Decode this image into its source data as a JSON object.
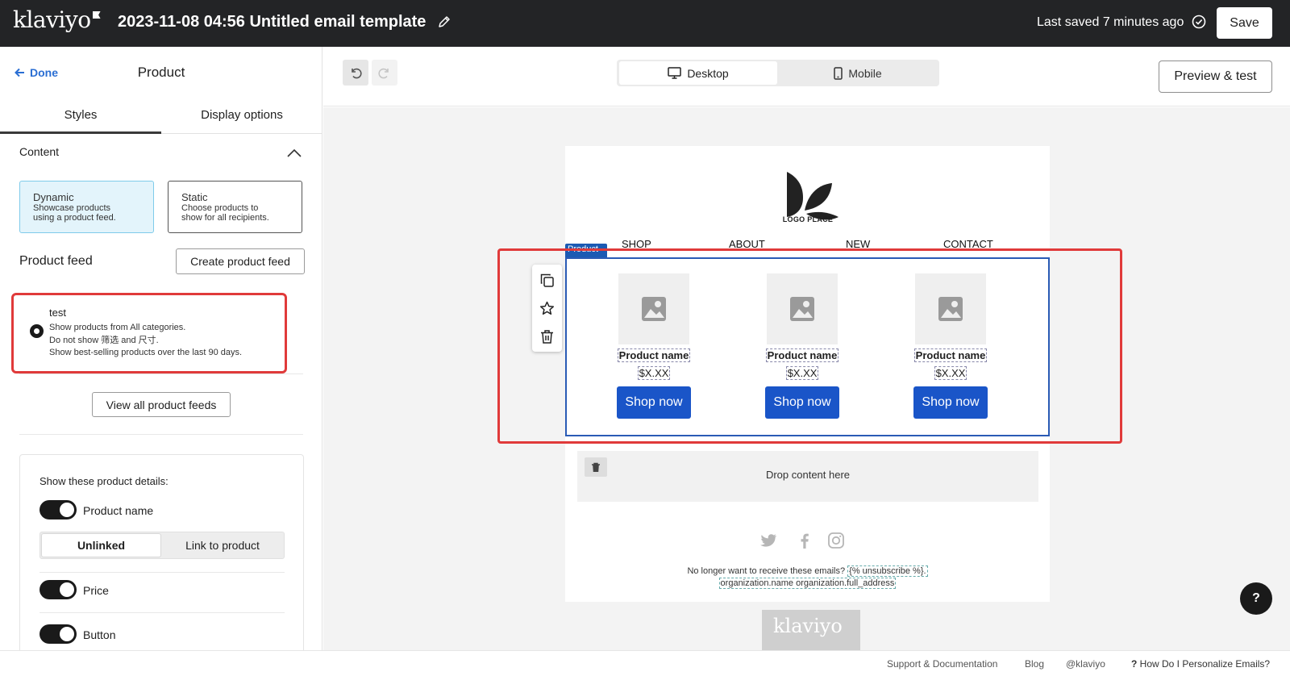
{
  "header": {
    "logo_text": "klaviyo",
    "title": "2023-11-08 04:56 Untitled email template",
    "saved_status": "Last saved 7 minutes ago",
    "save_label": "Save"
  },
  "panel": {
    "done_label": "Done",
    "title": "Product",
    "tabs": [
      "Styles",
      "Display options"
    ],
    "content_label": "Content",
    "modes": [
      {
        "title": "Dynamic",
        "desc1": "Showcase products",
        "desc2": "using a product feed."
      },
      {
        "title": "Static",
        "desc1": "Choose products to",
        "desc2": "show for all recipients."
      }
    ],
    "product_feed_label": "Product feed",
    "create_feed_label": "Create product feed",
    "feed": {
      "name": "test",
      "line1": "Show products from All categories.",
      "line2": "Do not show 筛选 and 尺寸.",
      "line3": "Show best-selling products over the last 90 days."
    },
    "view_all_label": "View all product feeds",
    "details_title": "Show these product details:",
    "toggles": [
      "Product name",
      "Price",
      "Button"
    ],
    "link_options": [
      "Unlinked",
      "Link to product"
    ]
  },
  "toolbar": {
    "desktop_label": "Desktop",
    "mobile_label": "Mobile",
    "preview_label": "Preview & test"
  },
  "email": {
    "logo_caption": "LOGO PLACE",
    "nav": [
      "SHOP",
      "ABOUT",
      "NEW",
      "CONTACT"
    ],
    "block_tag": "Product",
    "products": [
      {
        "name": "Product name",
        "price": "$X.XX",
        "button": "Shop now"
      },
      {
        "name": "Product name",
        "price": "$X.XX",
        "button": "Shop now"
      },
      {
        "name": "Product name",
        "price": "$X.XX",
        "button": "Shop now"
      }
    ],
    "drop_text": "Drop content here",
    "unsub_text": "No longer want to receive these emails?",
    "unsub_tag": "{% unsubscribe %}.",
    "org_name": "organization.name",
    "org_address": "organization.full_address",
    "footer_logo": "klaviyo"
  },
  "help_label": "?",
  "footer": {
    "links": [
      "Support & Documentation",
      "Blog",
      "@klaviyo",
      "How Do I Personalize Emails?"
    ]
  },
  "colors": {
    "topbar": "#232426",
    "accent_blue": "#1a55c8",
    "highlight_red": "#e03a3a",
    "link_blue": "#2a6ed3"
  }
}
